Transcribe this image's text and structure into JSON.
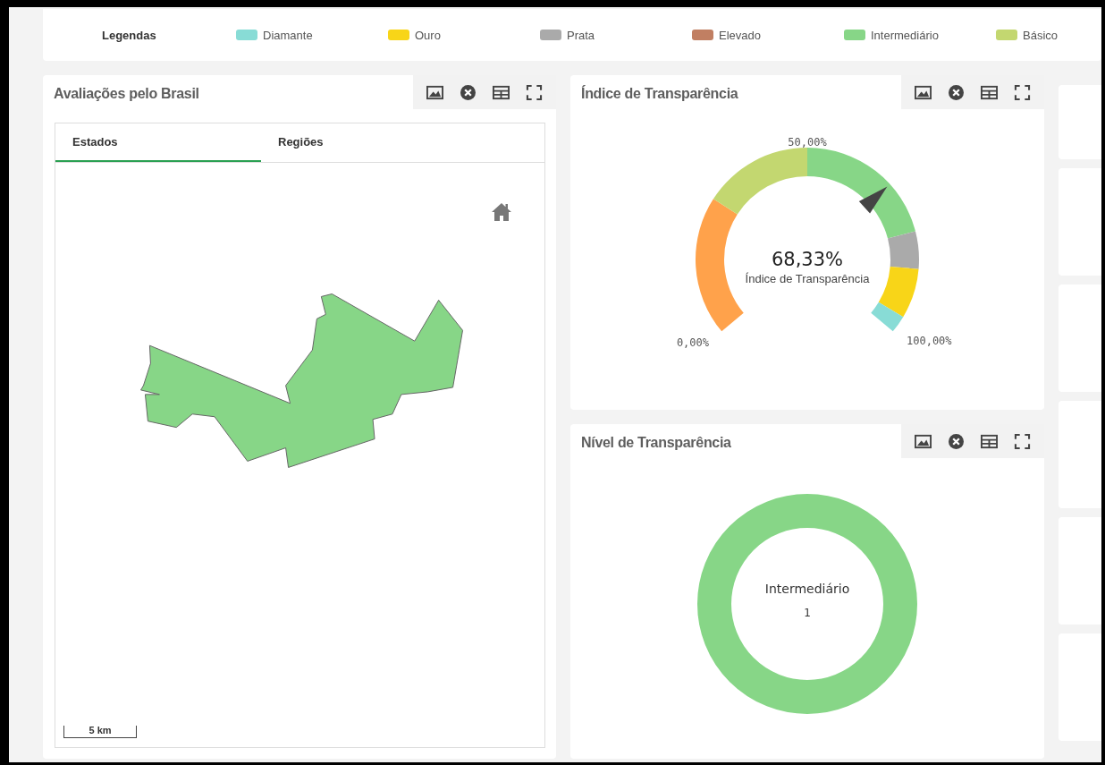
{
  "legend": {
    "title": "Legendas",
    "items": [
      {
        "label": "Diamante",
        "color": "#88dcd6"
      },
      {
        "label": "Ouro",
        "color": "#f8d518"
      },
      {
        "label": "Prata",
        "color": "#aaaaaa"
      },
      {
        "label": "Elevado",
        "color": "#c17f62"
      },
      {
        "label": "Intermediário",
        "color": "#87d687"
      },
      {
        "label": "Básico",
        "color": "#c3d770"
      }
    ]
  },
  "map_panel": {
    "title": "Avaliações pelo Brasil",
    "tabs": [
      {
        "label": "Estados",
        "selected": true
      },
      {
        "label": "Regiões",
        "selected": false
      }
    ],
    "scale": "5 km"
  },
  "gauge_panel": {
    "title": "Índice de Transparência",
    "value": "68,33%",
    "label": "Índice de Transparência",
    "ticks": {
      "min": "0,00%",
      "mid": "50,00%",
      "max": "100,00%"
    },
    "segments": [
      {
        "color": "#ffa24b"
      },
      {
        "color": "#c3d770"
      },
      {
        "color": "#87d687"
      },
      {
        "color": "#aaaaaa"
      },
      {
        "color": "#f8d518"
      },
      {
        "color": "#88dcd6"
      }
    ]
  },
  "level_panel": {
    "title": "Nível de Transparência",
    "center_label": "Intermediário",
    "count": "1",
    "color": "#87d687"
  }
}
